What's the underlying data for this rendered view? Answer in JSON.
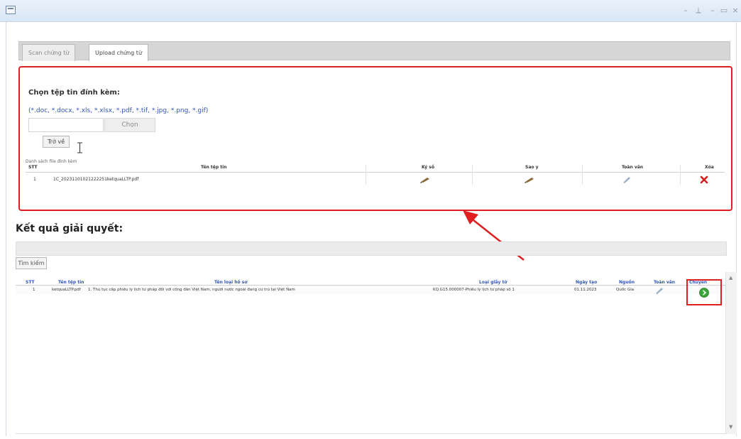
{
  "window": {
    "controls": [
      "–",
      "⟂",
      "–",
      "▭",
      "×"
    ]
  },
  "tabs": [
    {
      "label": "Scan chứng từ",
      "active": false
    },
    {
      "label": "Upload chứng từ",
      "active": true
    }
  ],
  "upload": {
    "title": "Chọn tệp tin đính kèm:",
    "formats": "(*.doc, *.docx, *.xls, *.xlsx, *.pdf, *.tif, *.jpg, *.png, *.gif)",
    "choose_label": "Chọn",
    "back_label": "Trở về",
    "list_caption": "Danh sách file đính kèm",
    "columns": [
      "STT",
      "Tên tệp tin",
      "Ký số",
      "Sao y",
      "Toàn văn",
      "Xóa"
    ],
    "rows": [
      {
        "stt": "1",
        "filename": "1C_20231101021222251ketquaLLTP.pdf"
      }
    ]
  },
  "result": {
    "title": "Kết quả giải quyết:",
    "search_label": "Tìm kiếm",
    "columns": [
      "STT",
      "Tên tệp tin",
      "Tên loại hồ sơ",
      "Loại giấy tờ",
      "Ngày tạo",
      "Nguồn",
      "Toàn văn",
      "Chuyển"
    ],
    "rows": [
      {
        "stt": "1",
        "filename": "ketquaLLTP.pdf",
        "record_type": "1. Thủ tục cấp phiếu lý lịch tư pháp đối với công dân Việt Nam, người nước ngoài đang cư trú tại Việt Nam",
        "doc_type": "KQ.G15.000007-Phiếu lý lịch tư pháp số 1",
        "created": "01.11.2023",
        "source": "Quốc Gia"
      }
    ]
  },
  "colors": {
    "highlight": "#e02020",
    "link": "#2f55b5",
    "go": "#3aa63a"
  }
}
